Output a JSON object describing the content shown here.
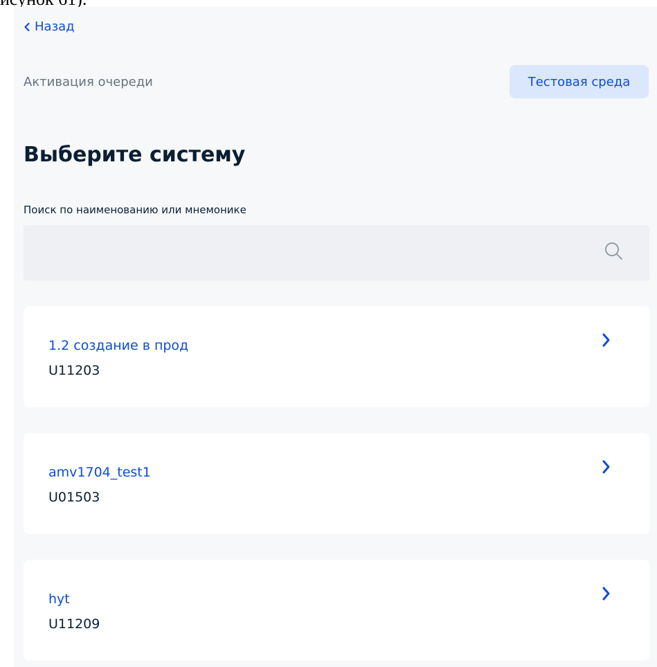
{
  "fragment": {
    "text": "исунок 61)."
  },
  "nav": {
    "back_label": "Назад"
  },
  "header": {
    "queue_title": "Активация очереди",
    "env_badge": "Тестовая среда"
  },
  "main": {
    "title": "Выберите систему",
    "search": {
      "label": "Поиск по наименованию или мнемонике",
      "value": "",
      "placeholder": ""
    },
    "systems": [
      {
        "name": "1.2 создание в прод",
        "code": "U11203"
      },
      {
        "name": "amv1704_test1",
        "code": "U01503"
      },
      {
        "name": "hyt",
        "code": "U11209"
      }
    ]
  },
  "colors": {
    "accent": "#0d4cd3",
    "badge_bg": "#dbe7fd",
    "panel_bg": "#f7f8fa",
    "input_bg": "#eef0f3",
    "text_dark": "#0b1f33",
    "text_muted": "#66727f"
  },
  "icons": {
    "back": "chevron-left-icon",
    "search": "search-icon",
    "card_arrow": "chevron-right-icon"
  }
}
